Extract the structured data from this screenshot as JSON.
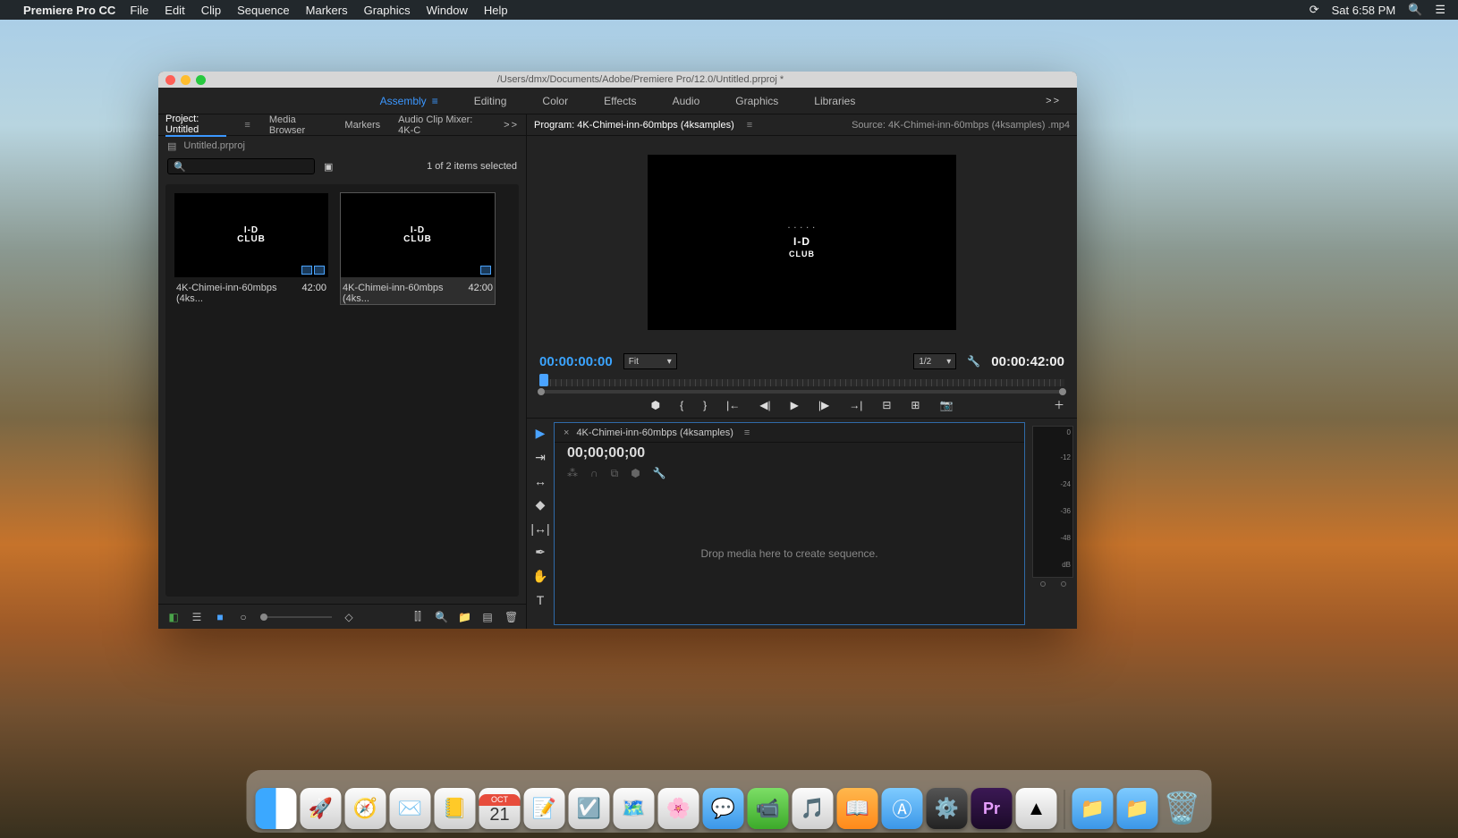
{
  "menubar": {
    "app_name": "Premiere Pro CC",
    "items": [
      "File",
      "Edit",
      "Clip",
      "Sequence",
      "Markers",
      "Graphics",
      "Window",
      "Help"
    ],
    "clock": "Sat 6:58 PM"
  },
  "window": {
    "title": "/Users/dmx/Documents/Adobe/Premiere Pro/12.0/Untitled.prproj *"
  },
  "workspaces": {
    "tabs": [
      "Assembly",
      "Editing",
      "Color",
      "Effects",
      "Audio",
      "Graphics",
      "Libraries"
    ],
    "active": "Assembly",
    "more": ">>"
  },
  "project_panel": {
    "tabs": [
      "Project: Untitled",
      "Media Browser",
      "Markers",
      "Audio Clip Mixer: 4K-C"
    ],
    "chev": ">>",
    "project_file": "Untitled.prproj",
    "search_placeholder": "",
    "selection_info": "1 of 2 items selected",
    "clips": [
      {
        "name": "4K-Chimei-inn-60mbps (4ks...",
        "duration": "42:00",
        "selected": false,
        "logo_line1": "I-D",
        "logo_line2": "CLUB"
      },
      {
        "name": "4K-Chimei-inn-60mbps (4ks...",
        "duration": "42:00",
        "selected": true,
        "logo_line1": "I-D",
        "logo_line2": "CLUB"
      }
    ]
  },
  "program_monitor": {
    "tab": "Program: 4K-Chimei-inn-60mbps (4ksamples)",
    "source_label": "Source: 4K-Chimei-inn-60mbps (4ksamples) .mp4",
    "logo_line1": "I-D",
    "logo_line2": "CLUB",
    "timecode_current": "00:00:00:00",
    "fit_label": "Fit",
    "zoom_label": "1/2",
    "duration": "00:00:42:00"
  },
  "timeline": {
    "tab_name": "4K-Chimei-inn-60mbps (4ksamples)",
    "timecode": "00;00;00;00",
    "drop_hint": "Drop media here to create sequence."
  },
  "audio_meters": {
    "ticks": [
      "0",
      "-12",
      "-24",
      "-36",
      "-48",
      "dB"
    ]
  },
  "dock": {
    "cal_month": "OCT",
    "cal_day": "21",
    "pr_label": "Pr"
  }
}
